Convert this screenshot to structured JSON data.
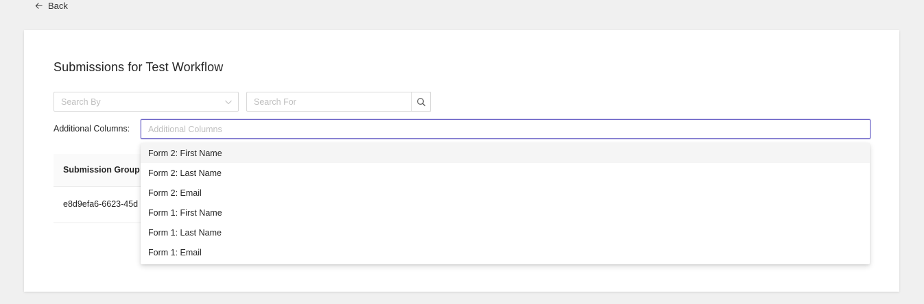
{
  "nav": {
    "back_label": "Back"
  },
  "page": {
    "title": "Submissions for Test Workflow"
  },
  "filters": {
    "search_by_placeholder": "Search By",
    "search_for_placeholder": "Search For"
  },
  "additional_columns": {
    "label": "Additional Columns:",
    "placeholder": "Additional Columns",
    "options": [
      "Form 2: First Name",
      "Form 2: Last Name",
      "Form 2: Email",
      "Form 1: First Name",
      "Form 1: Last Name",
      "Form 1: Email"
    ]
  },
  "table": {
    "columns": [
      "Submission Group"
    ],
    "rows": [
      [
        "e8d9efa6-6623-45d"
      ]
    ]
  },
  "colors": {
    "accent": "#6b63c7",
    "background": "#f0f0f0",
    "card": "#ffffff"
  },
  "icons": {
    "back": "arrow-left-icon",
    "dropdown": "chevron-down-icon",
    "search": "search-icon"
  }
}
